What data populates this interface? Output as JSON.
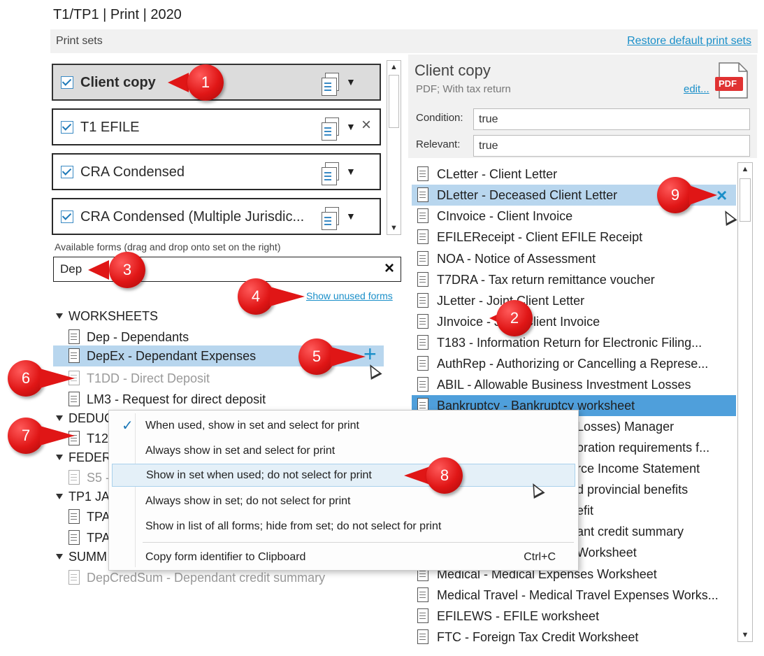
{
  "window": {
    "title": "T1/TP1 | Print | 2020"
  },
  "header": {
    "section_label": "Print sets",
    "restore_link": "Restore default print sets"
  },
  "print_sets": [
    {
      "label": "Client copy",
      "selected": true,
      "removable": false
    },
    {
      "label": "T1 EFILE",
      "selected": false,
      "removable": true
    },
    {
      "label": "CRA Condensed",
      "selected": false,
      "removable": false
    },
    {
      "label": "CRA Condensed (Multiple Jurisdic...",
      "selected": false,
      "removable": false
    }
  ],
  "available_forms": {
    "label": "Available forms (drag and drop onto set on the right)",
    "search_value": "Dep",
    "show_unused_link": "Show unused forms",
    "tree": {
      "worksheets": "WORKSHEETS",
      "dep": "Dep - Dependants",
      "depex": "DepEx - Dependant Expenses",
      "t1dd": "T1DD - Direct Deposit",
      "lm3": "LM3 - Request for direct deposit",
      "deduc": "DEDUC",
      "t12": "T12",
      "feder": "FEDER",
      "s5": "S5 -",
      "tp1ja": "TP1 JA",
      "tpa1": "TPA",
      "tpa2": "TPA",
      "summ": "SUMM",
      "depcredsum": "DepCredSum - Dependant credit summary"
    }
  },
  "detail": {
    "title": "Client copy",
    "subtitle": "PDF; With tax return",
    "edit_link": "edit...",
    "pdf_badge": "PDF",
    "condition_label": "Condition:",
    "condition_value": "true",
    "relevant_label": "Relevant:",
    "relevant_value": "true"
  },
  "set_forms": [
    "CLetter - Client Letter",
    "DLetter - Deceased Client Letter",
    "CInvoice - Client Invoice",
    "EFILEReceipt - Client EFILE Receipt",
    "NOA - Notice of Assessment",
    "T7DRA - Tax return remittance voucher",
    "JLetter - Joint Client Letter",
    "JInvoice - Joint Client Invoice",
    "T183 - Information Return for Electronic Filing...",
    "AuthRep - Authorizing or Cancelling a Represe...",
    "ABIL - Allowable Business Investment Losses",
    "Bankruptcy - Bankruptcy worksheet",
    "Losses) Manager",
    "oration requirements f...",
    "rce Income Statement",
    "d provincial benefits",
    "efit",
    "ant credit summary",
    "Worksheet",
    "Medical - Medical Expenses Worksheet",
    "Medical Travel - Medical Travel Expenses Works...",
    "EFILEWS - EFILE worksheet",
    "FTC - Foreign Tax Credit Worksheet"
  ],
  "context_menu": {
    "items": [
      "When used, show in set and select for print",
      "Always show in set and select for print",
      "Show in set when used; do not select for print",
      "Always show in set; do not select for print",
      "Show in list of all forms; hide from set; do not select for print"
    ],
    "copy_item": "Copy form identifier to Clipboard",
    "copy_shortcut": "Ctrl+C",
    "checked_index": 0,
    "hover_index": 2
  },
  "icons": {
    "check": "✓",
    "close": "×",
    "dropdown": "▼",
    "up": "▲",
    "down": "▼",
    "plus": "+"
  },
  "callouts": [
    "1",
    "2",
    "3",
    "4",
    "5",
    "6",
    "7",
    "8",
    "9"
  ],
  "colors": {
    "accent": "#1a8fc9",
    "highlight": "#b8d6ee",
    "selected_row": "#4f9fdb",
    "callout": "#e01616"
  }
}
